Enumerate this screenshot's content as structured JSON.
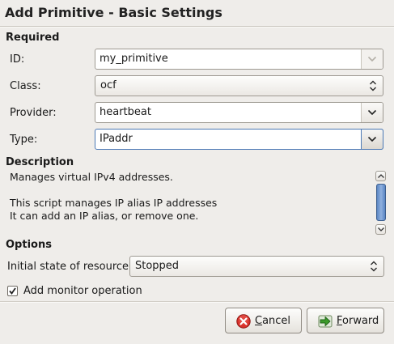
{
  "window": {
    "title": "Add Primitive - Basic Settings"
  },
  "required": {
    "heading": "Required",
    "id_label": "ID:",
    "id_value": "my_primitive",
    "class_label": "Class:",
    "class_value": "ocf",
    "provider_label": "Provider:",
    "provider_value": "heartbeat",
    "type_label": "Type:",
    "type_value": "IPaddr"
  },
  "description": {
    "heading": "Description",
    "lines": [
      "Manages virtual IPv4 addresses.",
      "",
      "This script manages IP alias IP addresses",
      "It can add an IP alias, or remove one."
    ],
    "scroll_fraction": 0.15
  },
  "options": {
    "heading": "Options",
    "initial_state_label": "Initial state of resource:",
    "initial_state_value": "Stopped",
    "monitor_label": "Add monitor operation",
    "monitor_checked": true
  },
  "buttons": {
    "cancel_mnemonic": "C",
    "cancel_rest": "ancel",
    "forward_mnemonic": "F",
    "forward_rest": "orward"
  },
  "colors": {
    "cancel_icon": "#d9322b",
    "forward_icon": "#3c9b2a",
    "focus": "#4c79b5"
  }
}
